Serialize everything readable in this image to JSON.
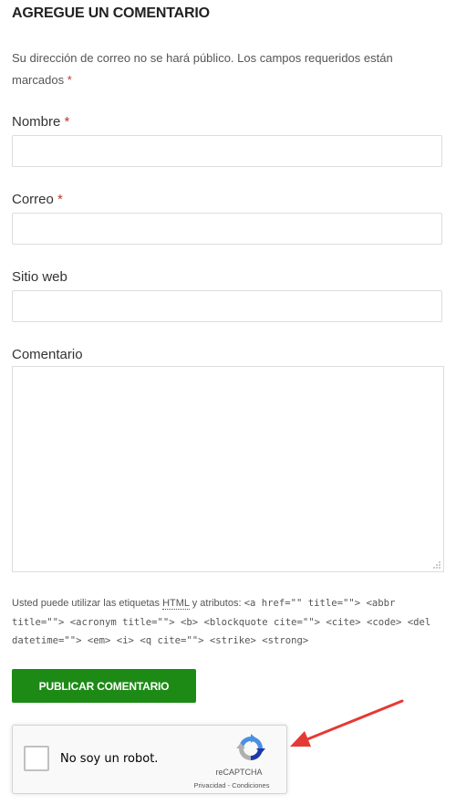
{
  "form": {
    "heading": "AGREGUE UN COMENTARIO",
    "notes_text": "Su dirección de correo no se hará público. Los campos requeridos están marcados",
    "required_mark": "*",
    "fields": {
      "name_label": "Nombre",
      "email_label": "Correo",
      "website_label": "Sitio web",
      "comment_label": "Comentario"
    },
    "allowed_tags_prefix": "Usted puede utilizar las etiquetas",
    "allowed_tags_abbr": "HTML",
    "allowed_tags_suffix": "y atributos:",
    "allowed_tags_code": "<a href=\"\" title=\"\"> <abbr title=\"\"> <acronym title=\"\"> <b> <blockquote cite=\"\"> <cite> <code> <del datetime=\"\"> <em> <i> <q cite=\"\"> <strike> <strong>",
    "submit_label": "PUBLICAR COMENTARIO"
  },
  "recaptcha": {
    "checkbox_label": "No soy un robot.",
    "brand": "reCAPTCHA",
    "links": "Privacidad - Condiciones",
    "logo_icon": "recaptcha-logo-icon"
  },
  "annotation": {
    "arrow_icon": "red-arrow-icon",
    "arrow_color": "#e53935"
  },
  "colors": {
    "submit_bg": "#1e8a16",
    "required": "#c0392b"
  }
}
